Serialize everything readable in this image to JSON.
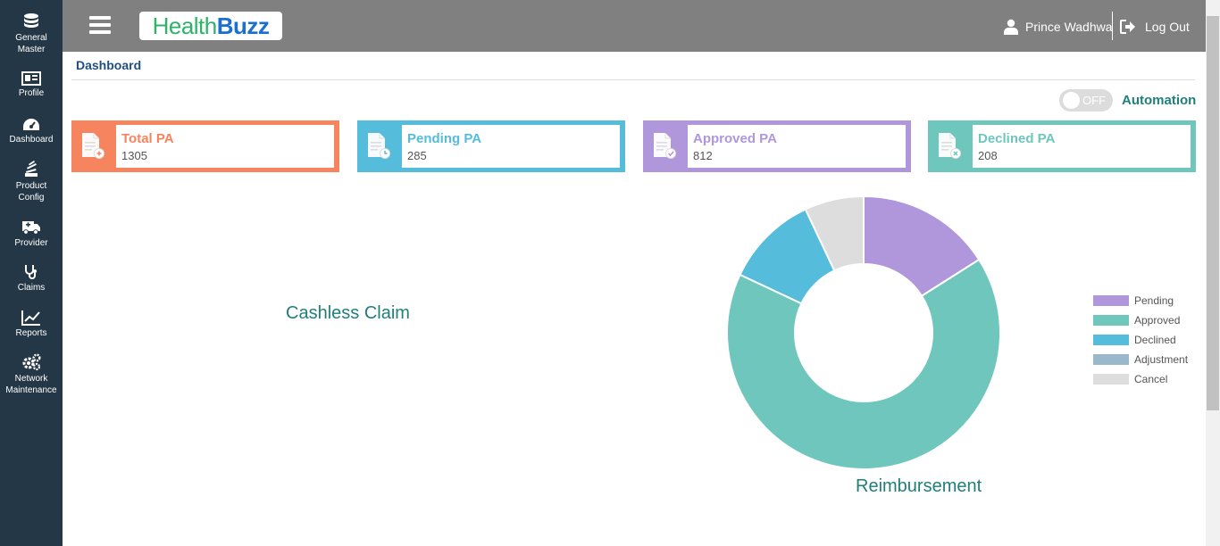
{
  "sidebar": {
    "items": [
      {
        "label_1": "General",
        "label_2": "Master",
        "icon": "database-icon"
      },
      {
        "label_1": "Profile",
        "label_2": "",
        "icon": "id-card-icon"
      },
      {
        "label_1": "Dashboard",
        "label_2": "",
        "icon": "gauge-icon"
      },
      {
        "label_1": "Product",
        "label_2": "Config",
        "icon": "stack-icon"
      },
      {
        "label_1": "Provider",
        "label_2": "",
        "icon": "ambulance-icon"
      },
      {
        "label_1": "Claims",
        "label_2": "",
        "icon": "stethoscope-icon"
      },
      {
        "label_1": "Reports",
        "label_2": "",
        "icon": "line-chart-icon"
      },
      {
        "label_1": "Network",
        "label_2": "Maintenance",
        "icon": "cogs-icon"
      }
    ]
  },
  "header": {
    "logo_part1": "Health",
    "logo_part2": "Buzz",
    "user_name": "Prince Wadhwa",
    "logout_label": "Log Out"
  },
  "breadcrumb": "Dashboard",
  "automation": {
    "toggle_state": "OFF",
    "label": "Automation"
  },
  "cards": [
    {
      "title": "Total PA",
      "value": "1305",
      "color": "#f5845f"
    },
    {
      "title": "Pending PA",
      "value": "285",
      "color": "#56bcdb"
    },
    {
      "title": "Approved PA",
      "value": "812",
      "color": "#b097db"
    },
    {
      "title": "Declined PA",
      "value": "208",
      "color": "#6fc6bd"
    }
  ],
  "chart_titles": {
    "left": "Cashless Claim",
    "right": "Reimbursement"
  },
  "chart_data": {
    "type": "pie",
    "title": "Reimbursement",
    "categories": [
      "Pending",
      "Approved",
      "Declined",
      "Adjustment",
      "Cancel"
    ],
    "values": [
      16,
      66,
      11,
      0,
      7
    ],
    "colors": [
      "#b097db",
      "#6fc6bd",
      "#56bcdb",
      "#9ab8cc",
      "#dddddd"
    ],
    "legend": "right"
  }
}
